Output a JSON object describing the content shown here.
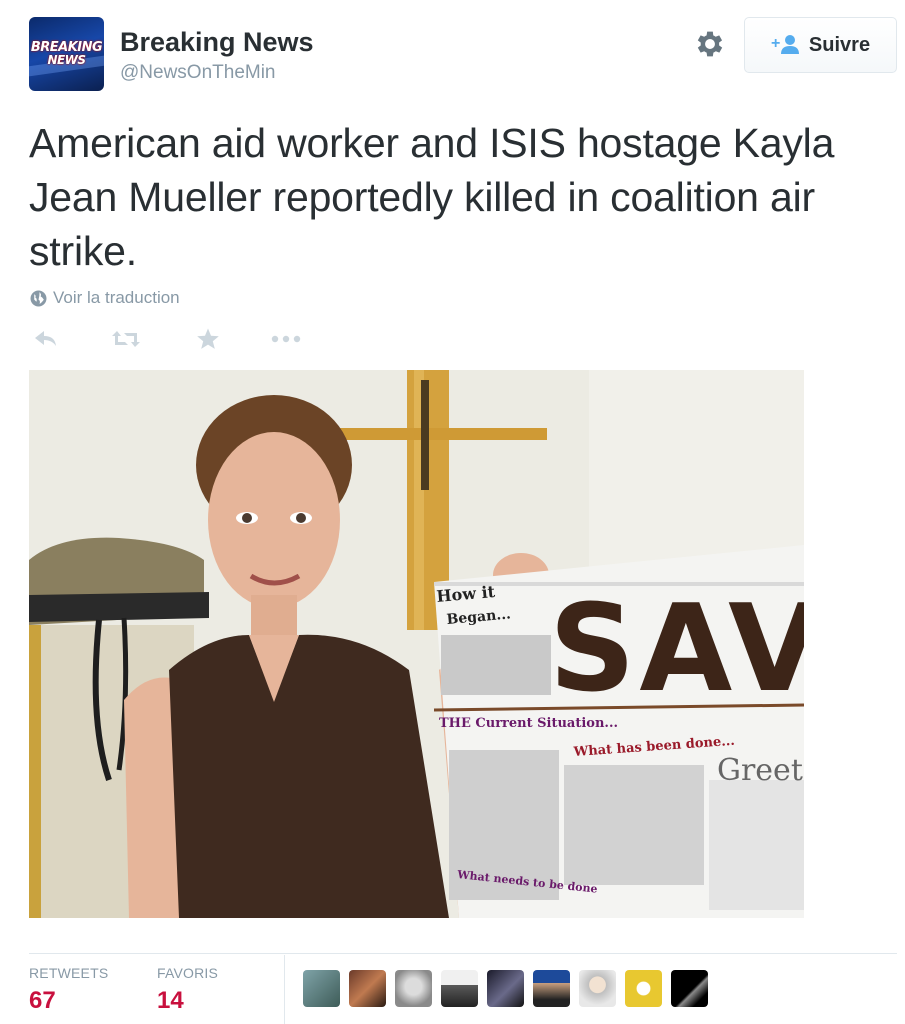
{
  "user": {
    "display_name": "Breaking News",
    "screen_name": "@NewsOnTheMin",
    "avatar_text_line1": "BREAKING",
    "avatar_text_line2": "NEWS"
  },
  "follow_button": {
    "label": "Suivre"
  },
  "tweet": {
    "text": "American aid worker and ISIS hostage Kayla Jean Mueller reportedly killed in coalition air strike.",
    "translate_label": "Voir la traduction"
  },
  "actions": [
    {
      "name": "reply",
      "icon": "reply-icon"
    },
    {
      "name": "retweet",
      "icon": "retweet-icon"
    },
    {
      "name": "favorite",
      "icon": "star-icon"
    },
    {
      "name": "more",
      "icon": "more-icon"
    }
  ],
  "photo": {
    "poster_lines": [
      "How it",
      "Began...",
      "SAV",
      "THE Current Situation...",
      "What has been done...",
      "Greet",
      "What needs to be done"
    ]
  },
  "stats": {
    "retweets_label": "RETWEETS",
    "retweets_value": "67",
    "favorites_label": "FAVORIS",
    "favorites_value": "14"
  },
  "colors": {
    "accent_count": "#c8103e",
    "muted_text": "#8899a6",
    "follow_icon": "#55acee"
  }
}
